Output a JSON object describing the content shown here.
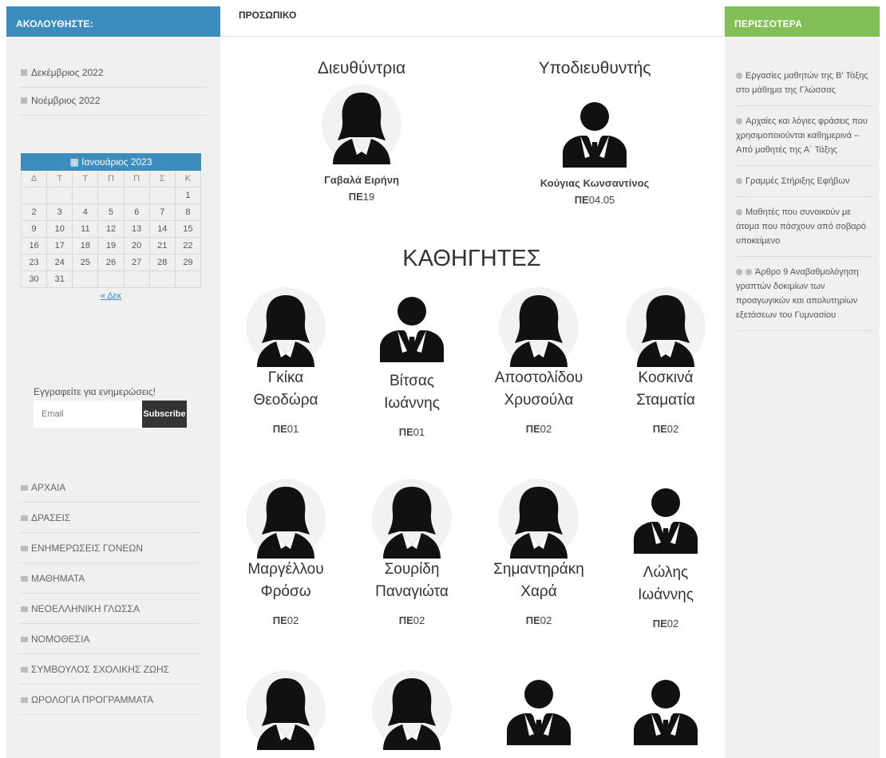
{
  "left_sidebar": {
    "title": "ΑΚΟΛΟΥΘΗΣΤΕ:",
    "archive": [
      "Δεκέμβριος 2022",
      "Νοέμβριος 2022"
    ],
    "calendar": {
      "month": "Ιανουάριος 2023",
      "weekdays": [
        "Δ",
        "Τ",
        "Τ",
        "Π",
        "Π",
        "Σ",
        "Κ"
      ],
      "rows": [
        [
          "",
          "",
          "",
          "",
          "",
          "",
          "1"
        ],
        [
          "2",
          "3",
          "4",
          "5",
          "6",
          "7",
          "8"
        ],
        [
          "9",
          "10",
          "11",
          "12",
          "13",
          "14",
          "15"
        ],
        [
          "16",
          "17",
          "18",
          "19",
          "20",
          "21",
          "22"
        ],
        [
          "23",
          "24",
          "25",
          "26",
          "27",
          "28",
          "29"
        ],
        [
          "30",
          "31",
          "",
          "",
          "",
          "",
          ""
        ]
      ],
      "prev_link": "« Δεκ"
    },
    "subscribe": {
      "label": "Εγγραφείτε για ενημερώσεις!",
      "placeholder": "Email",
      "button": "Subscribe"
    },
    "categories": [
      "ΑΡΧΑΙΑ",
      "ΔΡΑΣΕΙΣ",
      "ΕΝΗΜΕΡΩΣΕΙΣ ΓΟΝΕΩΝ",
      "ΜΑΘΗΜΑΤΑ",
      "ΝΕΟΕΛΛΗΝΙΚΗ ΓΛΩΣΣΑ",
      "ΝΟΜΟΘΕΣΙΑ",
      "ΣΥΜΒΟΥΛΟΣ ΣΧΟΛΙΚΗΣ ΖΩΗΣ",
      "ΩΡΟΛΟΓΙΑ ΠΡΟΓΡΑΜΜΑΤΑ"
    ]
  },
  "main": {
    "title": "ΠΡΟΣΩΠΙΚΟ",
    "director": {
      "role": "Διευθύντρια",
      "name": "Γαβαλά Ειρήνη",
      "pe_prefix": "ΠΕ",
      "pe_code": "19",
      "avatar": "female"
    },
    "deputy": {
      "role": "Υποδιευθυντής",
      "name": "Κούγιας Κωνσαντίνος",
      "pe_prefix": "ΠΕ",
      "pe_code": "04.05",
      "avatar": "male"
    },
    "section_title": "ΚΑΘΗΓΗΤΕΣ",
    "teachers": [
      {
        "line1": "Γκίκα",
        "line2": "Θεοδώρα",
        "pe_prefix": "ΠΕ",
        "pe_code": "01",
        "avatar": "female"
      },
      {
        "line1": "Βίτσας",
        "line2": "Ιωάννης",
        "pe_prefix": "ΠΕ",
        "pe_code": "01",
        "avatar": "male"
      },
      {
        "line1": "Αποστολίδου",
        "line2": "Χρυσούλα",
        "pe_prefix": "ΠΕ",
        "pe_code": "02",
        "avatar": "female"
      },
      {
        "line1": "Κοσκινά",
        "line2": "Σταματία",
        "pe_prefix": "ΠΕ",
        "pe_code": "02",
        "avatar": "female"
      },
      {
        "line1": "Μαργέλλου",
        "line2": "Φρόσω",
        "pe_prefix": "ΠΕ",
        "pe_code": "02",
        "avatar": "female"
      },
      {
        "line1": "Σουρίδη",
        "line2": "Παναγιώτα",
        "pe_prefix": "ΠΕ",
        "pe_code": "02",
        "avatar": "female"
      },
      {
        "line1": "Σημαντηράκη",
        "line2": "Χαρά",
        "pe_prefix": "ΠΕ",
        "pe_code": "02",
        "avatar": "female"
      },
      {
        "line1": "Λώλης",
        "line2": "Ιωάννης",
        "pe_prefix": "ΠΕ",
        "pe_code": "02",
        "avatar": "male"
      },
      {
        "avatar": "female"
      },
      {
        "avatar": "female"
      },
      {
        "avatar": "male"
      },
      {
        "avatar": "male"
      }
    ]
  },
  "right_sidebar": {
    "title": "ΠΕΡΙΣΣΟΤΕΡΑ",
    "items": [
      {
        "icons": 1,
        "text": "Εργασίες μαθητών της Β' Τάξης στο μάθημα της Γλώσσας"
      },
      {
        "icons": 1,
        "text": "Αρχαίες και λόγιες φράσεις που χρησιμοποιούνται καθημερινά – Από μαθητές της Α΄ Τάξης"
      },
      {
        "icons": 1,
        "text": "Γραμμές Στήριξης Εφήβων"
      },
      {
        "icons": 1,
        "text": "Μαθητές που συνοικούν με άτομα που πάσχουν από σοβαρό υποκείμενο"
      },
      {
        "icons": 2,
        "text": "Άρθρο 9 Αναβαθμολόγηση γραπτών δοκιμίων των προαγωγικών και απολυτηρίων εξετάσεων του Γυμνασίου"
      }
    ]
  },
  "colors": {
    "blue_header": "#3b8dbd",
    "green_header": "#82bf56",
    "sidebar_bg": "#f0f0f0"
  }
}
